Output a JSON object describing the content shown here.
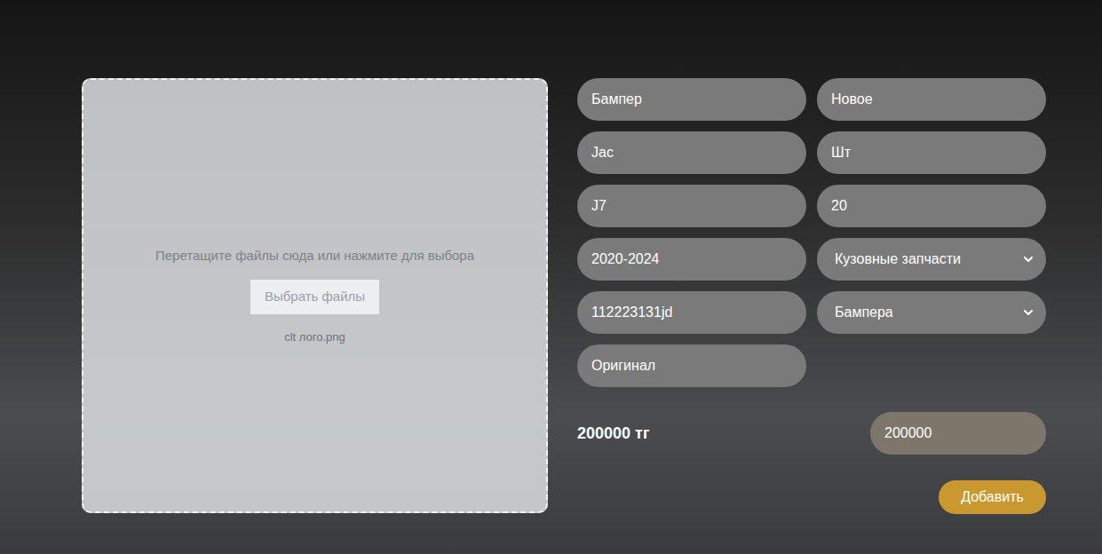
{
  "dropzone": {
    "hint": "Перетащите файлы сюда или нажмите для выбора",
    "button": "Выбрать файлы",
    "file_name": "clt лого.png"
  },
  "left_fields": [
    {
      "kind": "input",
      "value": "Бампер"
    },
    {
      "kind": "input",
      "value": "Jac"
    },
    {
      "kind": "input",
      "value": "J7"
    },
    {
      "kind": "input",
      "value": "2020-2024"
    },
    {
      "kind": "input",
      "value": "112223131jd"
    },
    {
      "kind": "input",
      "value": "Оригинал"
    }
  ],
  "right_fields": [
    {
      "kind": "input",
      "value": "Новое"
    },
    {
      "kind": "input",
      "value": "Шт"
    },
    {
      "kind": "input",
      "value": "20"
    },
    {
      "kind": "select",
      "value": "Кузовные запчасти"
    },
    {
      "kind": "select",
      "value": "Бампера"
    }
  ],
  "price": {
    "label": "200000 тг",
    "value": "200000"
  },
  "submit": "Добавить"
}
